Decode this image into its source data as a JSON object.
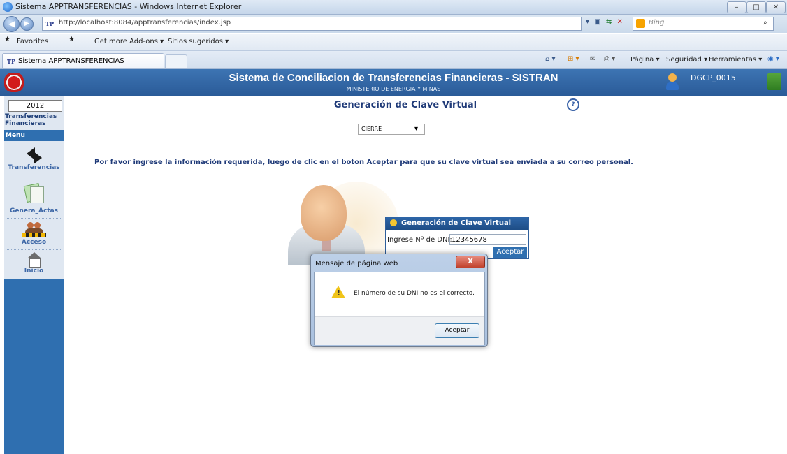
{
  "window": {
    "title": "Sistema APPTRANSFERENCIAS - Windows Internet Explorer",
    "controls": [
      "–",
      "□",
      "✕"
    ]
  },
  "address_bar": {
    "url": "http://localhost:8084/apptransferencias/index.jsp",
    "site_badge": "TP",
    "search_placeholder": "Bing",
    "back_glyph": "◀",
    "forward_glyph": "▶"
  },
  "favorites_bar": {
    "favorites_label": "Favorites",
    "items": [
      "Get more Add-ons ▾",
      "Sitios sugeridos ▾"
    ]
  },
  "tab": {
    "label": "Sistema APPTRANSFERENCIAS",
    "badge": "TP"
  },
  "command_bar": {
    "items": [
      "Página ▾",
      "Seguridad ▾",
      "Herramientas ▾"
    ]
  },
  "header": {
    "title": "Sistema de Conciliacion de Transferencias Financieras - SISTRAN",
    "subtitle": "MINISTERIO DE ENERGIA Y MINAS",
    "username": "DGCP_0015"
  },
  "sidebar": {
    "year": "2012",
    "section_title_line1": "Transferencias",
    "section_title_line2": "Financieras",
    "menu_label": "Menu",
    "items": [
      {
        "label": "Transferencias",
        "icon": "transfer-arrows-icon"
      },
      {
        "label": "Genera_Actas",
        "icon": "documents-icon"
      },
      {
        "label": "Acceso",
        "icon": "users-key-icon"
      },
      {
        "label": "Inicio",
        "icon": "home-icon"
      }
    ]
  },
  "main": {
    "title": "Generación de Clave Virtual",
    "help_glyph": "?",
    "select_value": "CIERRE",
    "select_arrow": "▾",
    "instructions": "Por favor ingrese la información requerida, luego de clic en el boton Aceptar para que su clave virtual sea enviada a su correo personal."
  },
  "login_card": {
    "title": "Generación de Clave Virtual",
    "dni_label": "Ingrese Nº de DNI:",
    "dni_value": "12345678",
    "submit_label": "Aceptar"
  },
  "dialog": {
    "title": "Mensaje de página web",
    "close_glyph": "X",
    "warning_glyph": "!",
    "message": "El número de su DNI no es el correcto.",
    "ok_label": "Aceptar"
  }
}
